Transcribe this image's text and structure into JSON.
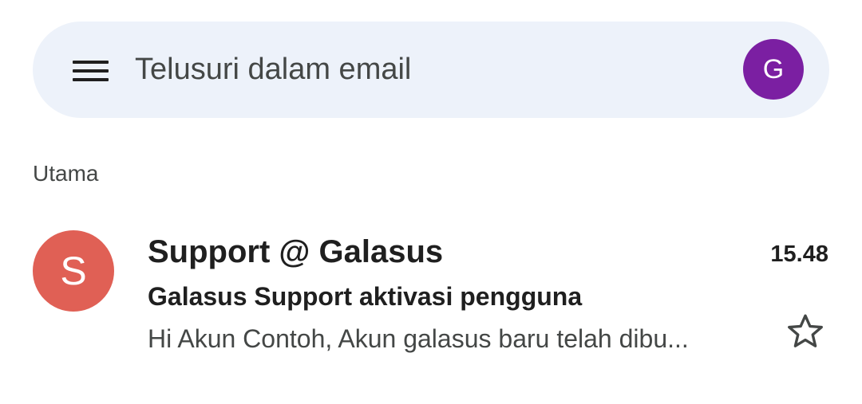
{
  "search": {
    "placeholder": "Telusuri dalam email",
    "menu_icon": "hamburger-menu-icon",
    "account_initial": "G",
    "account_color": "#7b1fa2"
  },
  "section": {
    "label": "Utama"
  },
  "emails": [
    {
      "sender": "Support @ Galasus",
      "avatar_initial": "S",
      "avatar_color": "#e06055",
      "time": "15.48",
      "subject": "Galasus Support aktivasi pengguna",
      "snippet": "Hi Akun Contoh, Akun galasus baru telah dibu...",
      "star_icon": "star-outline-icon",
      "unread": true
    }
  ],
  "colors": {
    "search_bar_bg": "#edf2fa",
    "text_primary": "#1f1f1f",
    "text_secondary": "#444746"
  }
}
